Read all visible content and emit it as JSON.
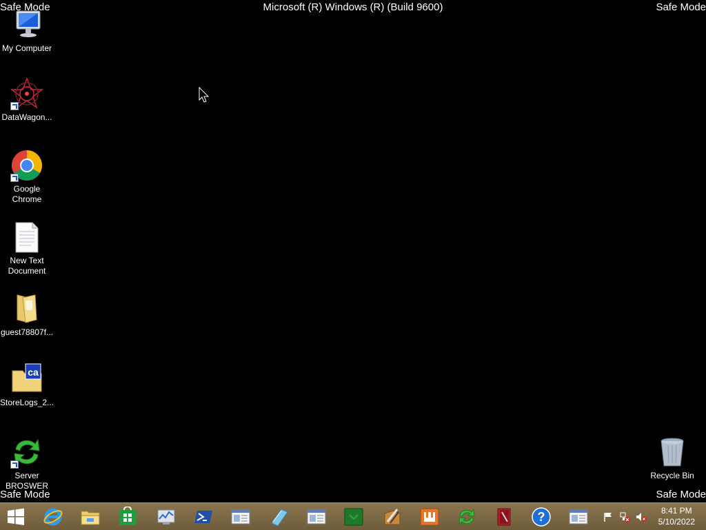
{
  "overlay": {
    "safe_mode": "Safe Mode",
    "build": "Microsoft (R) Windows (R) (Build 9600)"
  },
  "desktop_icons": [
    {
      "label": "My Computer",
      "icon": "computer-icon"
    },
    {
      "label": "DataWagon...",
      "icon": "datawagon-icon"
    },
    {
      "label": "Google Chrome",
      "icon": "chrome-icon"
    },
    {
      "label": "New Text Document",
      "icon": "text-document-icon"
    },
    {
      "label": "guest78807f...",
      "icon": "folder-icon"
    },
    {
      "label": "StoreLogs_2...",
      "icon": "ca-folder-icon"
    },
    {
      "label": "Server BROSWER",
      "icon": "sync-arrows-icon"
    },
    {
      "label": "Recycle Bin",
      "icon": "recycle-bin-icon"
    }
  ],
  "taskbar": {
    "items": [
      "start-icon",
      "internet-explorer-icon",
      "file-explorer-icon",
      "store-icon",
      "performance-monitor-icon",
      "powershell-icon",
      "window-app-icon",
      "notepad-icon",
      "window-app-icon",
      "green-app-icon",
      "tools-icon",
      "orange-app-icon",
      "sync-arrows-icon",
      "book-icon",
      "help-icon",
      "window-app-icon"
    ],
    "tray": [
      "flag-icon",
      "network-error-icon",
      "volume-muted-icon"
    ],
    "clock": {
      "time": "8:41 PM",
      "date": "5/10/2022"
    }
  },
  "colors": {
    "desktop_bg": "#000000",
    "taskbar_bg": "#7d6a46"
  }
}
